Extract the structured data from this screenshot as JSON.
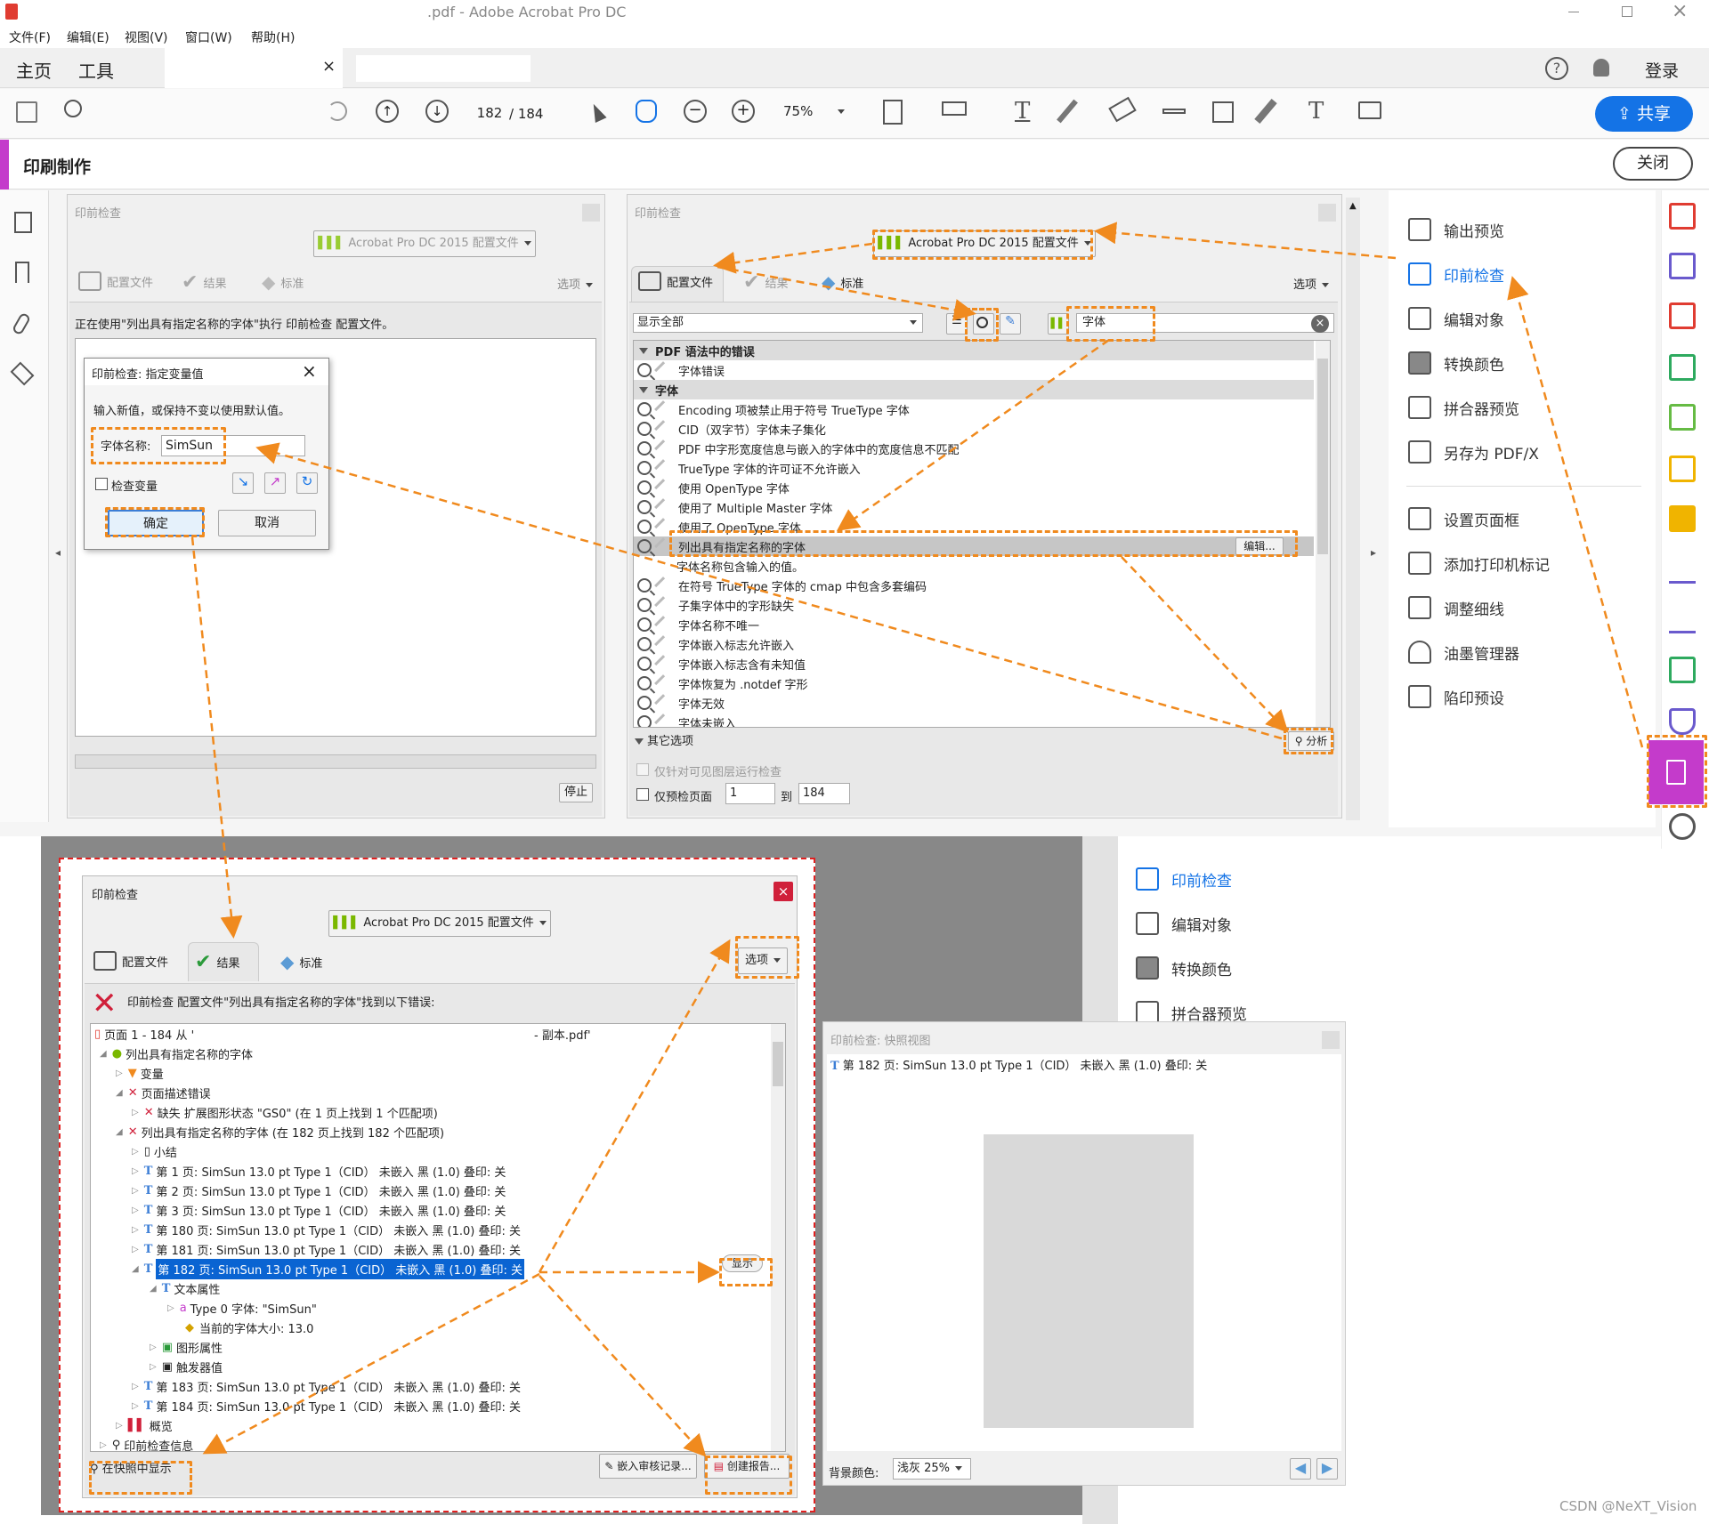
{
  "app": {
    "title": ".pdf - Adobe Acrobat Pro DC"
  },
  "menu": [
    "文件(F)",
    "编辑(E)",
    "视图(V)",
    "窗口(W)",
    "帮助(H)"
  ],
  "tabs": {
    "home": "主页",
    "tools": "工具",
    "close": "×"
  },
  "header": {
    "signin": "登录",
    "share": "共享",
    "close_label": "关闭"
  },
  "toolbar": {
    "page_current": "182",
    "page_total": "/ 184",
    "zoom": "75%"
  },
  "tool_title": "印刷制作",
  "left_panel": {
    "title": "印前检查",
    "profile_btn": "Acrobat Pro DC 2015 配置文件",
    "tabs": [
      "配置文件",
      "结果",
      "标准"
    ],
    "options": "选项",
    "info": "正在使用\"列出具有指定名称的字体\"执行 印前检查 配置文件。",
    "stop": "停止"
  },
  "var_dialog": {
    "title": "印前检查: 指定变量值",
    "desc": "输入新值，或保持不变以使用默认值。",
    "field_label": "字体名称:",
    "field_value": "SimSun",
    "check_label": "检查变量",
    "ok": "确定",
    "cancel": "取消"
  },
  "right_panel": {
    "title": "印前检查",
    "profile_btn": "Acrobat Pro DC 2015 配置文件",
    "tabs": [
      "配置文件",
      "结果",
      "标准"
    ],
    "options": "选项",
    "filter": "显示全部",
    "search": "字体",
    "groups": [
      {
        "name": "PDF 语法中的错误",
        "items": [
          "字体错误"
        ]
      },
      {
        "name": "字体",
        "items": []
      }
    ],
    "items": [
      "Encoding 项被禁止用于符号 TrueType 字体",
      "CID（双字节）字体未子集化",
      "PDF 中字形宽度信息与嵌入的字体中的宽度信息不匹配",
      "TrueType 字体的许可证不允许嵌入",
      "使用 OpenType 字体",
      "使用了 Multiple Master 字体",
      "使用了 OpenType 字体",
      "列出具有指定名称的字体",
      "字体名称包含输入的值。",
      "在符号 TrueType 字体的 cmap 中包含多套编码",
      "子集字体中的字形缺失",
      "字体名称不唯一",
      "字体嵌入标志允许嵌入",
      "字体嵌入标志含有未知值",
      "字体恢复为 .notdef 字形",
      "字体无效",
      "字体未嵌入"
    ],
    "edit": "编辑...",
    "more": "其它选项",
    "analyze": "分析",
    "visible_only": "仅针对可见图层运行检查",
    "page_only": "仅预检页面",
    "from": "1",
    "to_label": "到",
    "to": "184"
  },
  "right_tools": [
    "输出预览",
    "印前检查",
    "编辑对象",
    "转换颜色",
    "拼合器预览",
    "另存为 PDF/X",
    "设置页面框",
    "添加打印机标记",
    "调整细线",
    "油墨管理器",
    "陷印预设"
  ],
  "results": {
    "title": "印前检查",
    "profile_btn": "Acrobat Pro DC 2015 配置文件",
    "tabs": [
      "配置文件",
      "结果",
      "标准"
    ],
    "options": "选项",
    "summary": "印前检查 配置文件\"列出具有指定名称的字体\"找到以下错误:",
    "tree": [
      "页面 1 - 184 从 '",
      "- 副本.pdf'",
      "列出具有指定名称的字体",
      "变量",
      "页面描述错误",
      "缺失 扩展图形状态 \"GS0\" (在 1 页上找到 1 个匹配项)",
      "列出具有指定名称的字体 (在 182 页上找到 182 个匹配项)",
      "小结",
      "第 1 页: SimSun 13.0 pt Type 1（CID） 未嵌入 黑 (1.0) 叠印: 关",
      "第 2 页: SimSun 13.0 pt Type 1（CID） 未嵌入 黑 (1.0) 叠印: 关",
      "第 3 页: SimSun 13.0 pt Type 1（CID） 未嵌入 黑 (1.0) 叠印: 关",
      "第 180 页: SimSun 13.0 pt Type 1（CID） 未嵌入 黑 (1.0) 叠印: 关",
      "第 181 页: SimSun 13.0 pt Type 1（CID） 未嵌入 黑 (1.0) 叠印: 关",
      "第 182 页: SimSun 13.0 pt Type 1（CID） 未嵌入 黑 (1.0) 叠印: 关",
      "文本属性",
      "Type 0 字体: \"SimSun\"",
      "当前的字体大小: 13.0",
      "图形属性",
      "触发器值",
      "第 183 页: SimSun 13.0 pt Type 1（CID） 未嵌入 黑 (1.0) 叠印: 关",
      "第 184 页: SimSun 13.0 pt Type 1（CID） 未嵌入 黑 (1.0) 叠印: 关",
      "概览",
      "印前检查信息"
    ],
    "show": "显示",
    "snapshot_btn": "在快照中显示",
    "embed_btn": "嵌入审核记录...",
    "report_btn": "创建报告..."
  },
  "right_tools_2": [
    "印前检查",
    "编辑对象",
    "转换颜色",
    "拼合器预览"
  ],
  "snapshot": {
    "title": "印前检查: 快照视图",
    "line": "第 182 页: SimSun 13.0 pt Type 1（CID） 未嵌入 黑 (1.0) 叠印: 关",
    "bg_label": "背景颜色:",
    "bg_value": "浅灰 25%"
  },
  "watermark": "CSDN @NeXT_Vision",
  "colors": {
    "accent": "#1473e6",
    "highlight": "#f08a1e",
    "selection": "#0a64d2",
    "tool_purple": "#c43bcb"
  }
}
